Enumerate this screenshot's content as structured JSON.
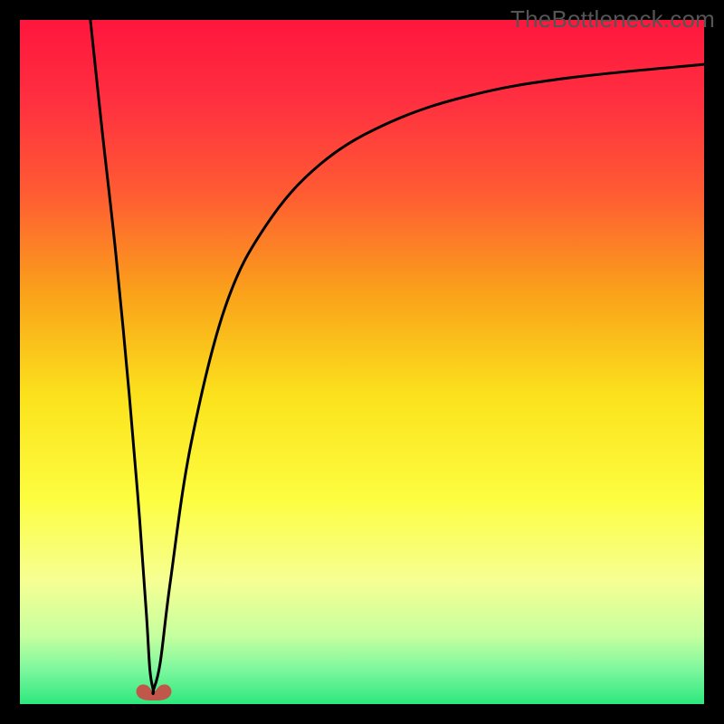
{
  "watermark": "TheBottleneck.com",
  "gradient": {
    "stops": [
      {
        "offset": 0.0,
        "color": "#ff163d"
      },
      {
        "offset": 0.12,
        "color": "#ff3040"
      },
      {
        "offset": 0.25,
        "color": "#ff5a33"
      },
      {
        "offset": 0.4,
        "color": "#faa21a"
      },
      {
        "offset": 0.55,
        "color": "#fbe21c"
      },
      {
        "offset": 0.7,
        "color": "#fdfd40"
      },
      {
        "offset": 0.82,
        "color": "#f6ff93"
      },
      {
        "offset": 0.9,
        "color": "#c6ff9f"
      },
      {
        "offset": 0.95,
        "color": "#7cf79e"
      },
      {
        "offset": 1.0,
        "color": "#2de87d"
      }
    ]
  },
  "marker": {
    "cx": 148,
    "cy": 736,
    "r": 16,
    "fill": "#c1564a"
  },
  "chart_data": {
    "type": "line",
    "title": "",
    "xlabel": "",
    "ylabel": "",
    "xlim": [
      0,
      100
    ],
    "ylim": [
      0,
      100
    ],
    "notch_x_percent": 19.5,
    "series": [
      {
        "name": "left-branch",
        "x": [
          10.3,
          12,
          14,
          16,
          17.5,
          18.5,
          19.0,
          19.5
        ],
        "y": [
          100,
          84,
          66,
          45,
          27,
          13,
          5,
          2
        ]
      },
      {
        "name": "right-branch",
        "x": [
          19.5,
          20.5,
          22,
          25,
          30,
          36,
          44,
          54,
          66,
          80,
          100
        ],
        "y": [
          2,
          6,
          18,
          38,
          58,
          70,
          79,
          85,
          89,
          91.5,
          93.5
        ]
      }
    ]
  }
}
